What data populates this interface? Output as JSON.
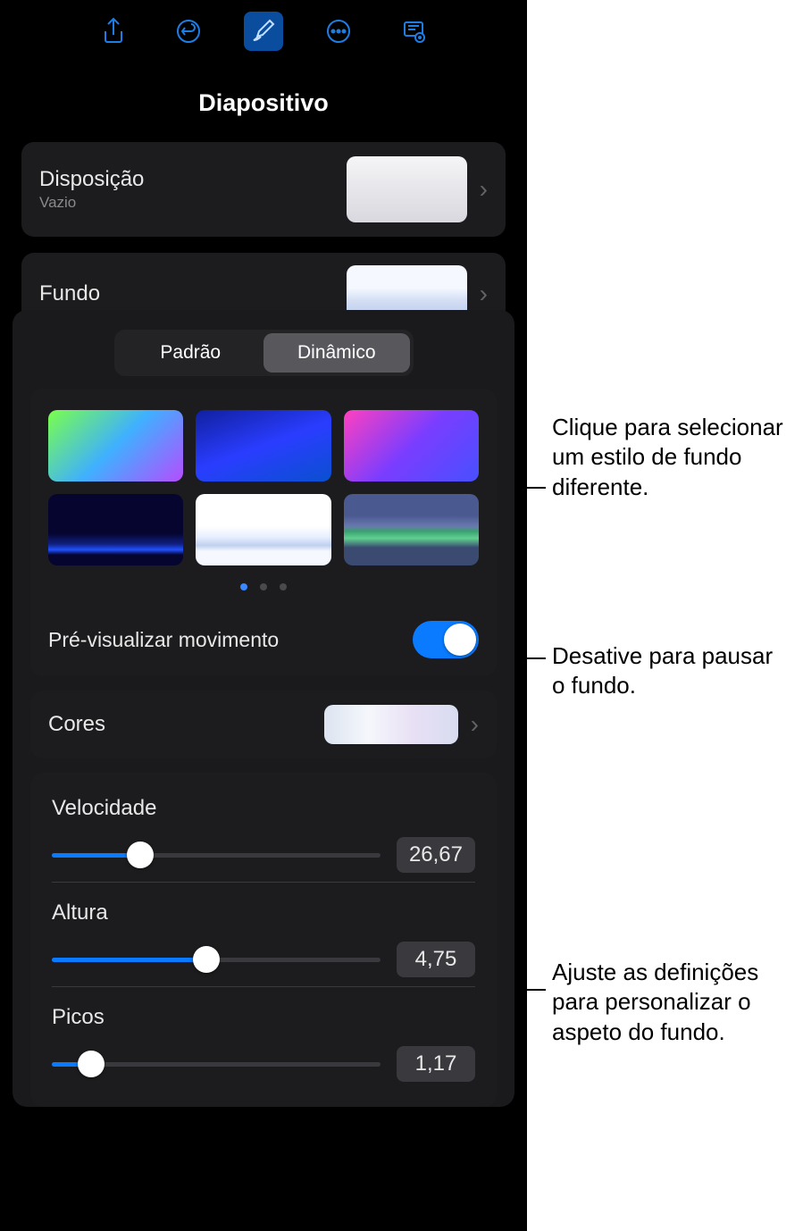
{
  "panel": {
    "title": "Diapositivo"
  },
  "disposition": {
    "label": "Disposição",
    "sublabel": "Vazio"
  },
  "background": {
    "label": "Fundo"
  },
  "tabs": {
    "standard": "Padrão",
    "dynamic": "Dinâmico"
  },
  "preview": {
    "label": "Pré-visualizar movimento",
    "on": true
  },
  "colors": {
    "label": "Cores"
  },
  "sliders": {
    "speed": {
      "label": "Velocidade",
      "value": "26,67",
      "pct": 27
    },
    "height": {
      "label": "Altura",
      "value": "4,75",
      "pct": 47
    },
    "peaks": {
      "label": "Picos",
      "value": "1,17",
      "pct": 12
    }
  },
  "callouts": {
    "style": "Clique para selecionar um estilo de fundo diferente.",
    "toggle": "Desative para pausar o fundo.",
    "sliders": "Ajuste as definições para personalizar o aspeto do fundo."
  }
}
